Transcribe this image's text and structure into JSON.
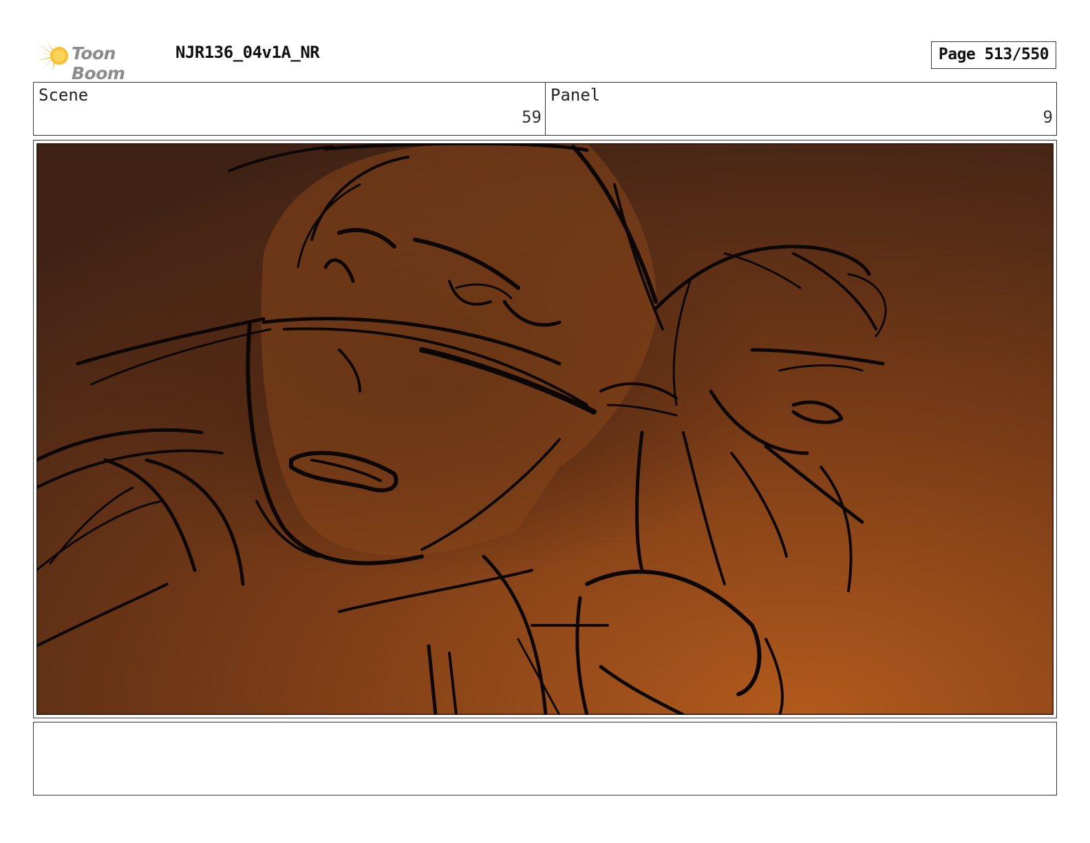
{
  "header": {
    "brand": "Toon Boom",
    "project": "NJR136_04v1A_NR",
    "page": "Page 513/550"
  },
  "info": {
    "scene_label": "Scene",
    "scene_value": "59",
    "panel_label": "Panel",
    "panel_value": "9"
  },
  "notes": {
    "text": ""
  },
  "colors": {
    "logo_star": "#f6b21b",
    "frame_dark": "#3a1f12",
    "frame_mid": "#6b3516",
    "frame_warm": "#a6521a",
    "ink": "#0c0704"
  }
}
